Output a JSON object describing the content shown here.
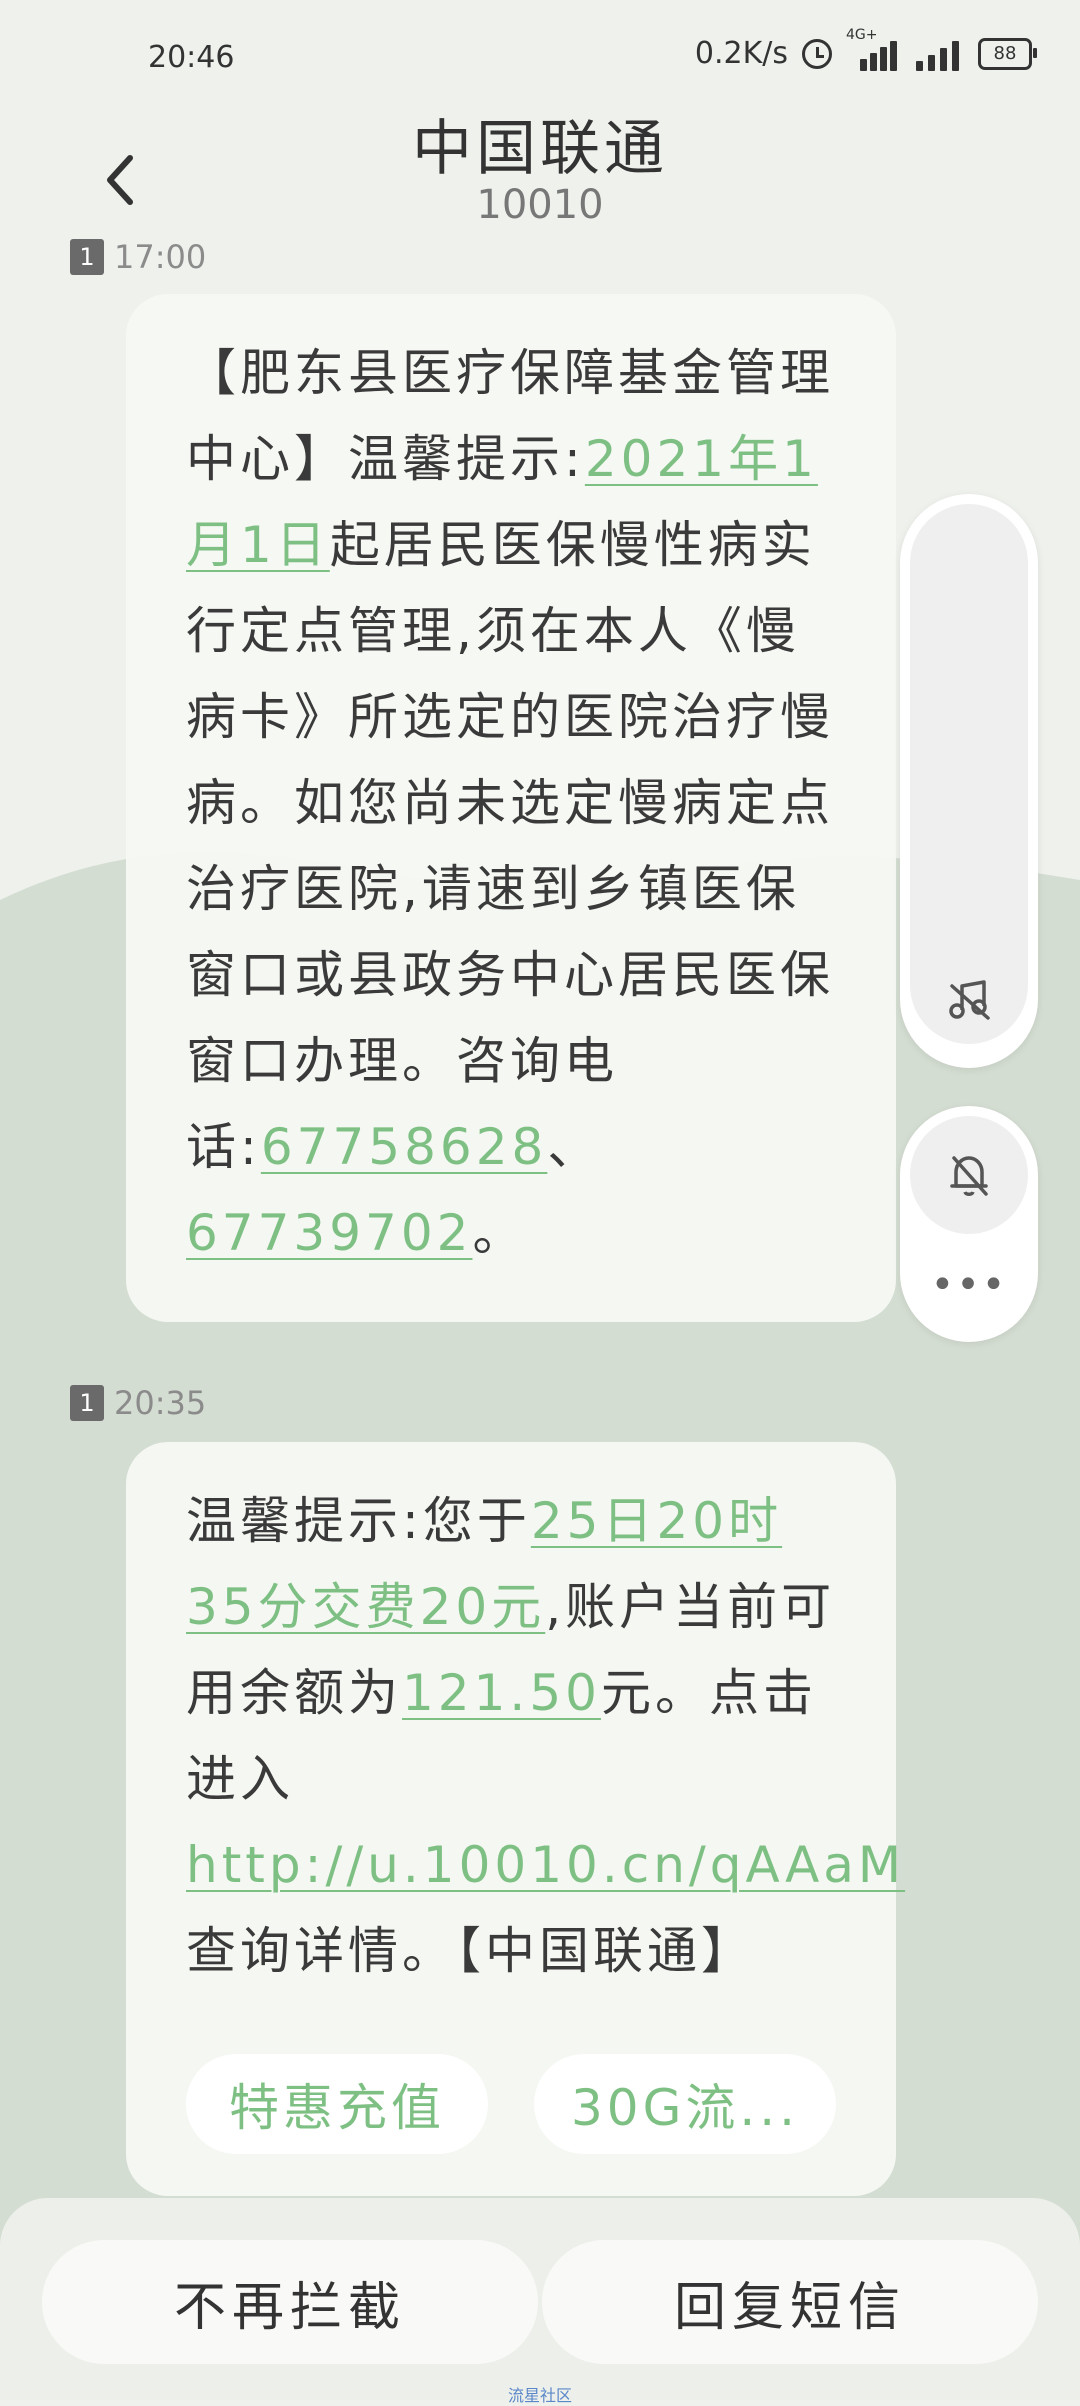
{
  "status_bar": {
    "time": "20:46",
    "speed": "0.2K/s",
    "network_tag": "4G+",
    "battery": "88"
  },
  "header": {
    "title": "中国联通",
    "number": "10010"
  },
  "messages": [
    {
      "sim": "1",
      "time": "17:00",
      "parts": [
        {
          "t": "【肥东县医疗保障基金管理中心】温馨提示:"
        },
        {
          "t": "2021年1月1日",
          "link": true
        },
        {
          "t": "起居民医保慢性病实行定点管理,须在本人《慢病卡》所选定的医院治疗慢病。如您尚未选定慢病定点治疗医院,请速到乡镇医保窗口或县政务中心居民医保窗口办理。咨询电话:"
        },
        {
          "t": "67758628",
          "link": true
        },
        {
          "t": "、"
        },
        {
          "t": "67739702",
          "link": true
        },
        {
          "t": "。"
        }
      ]
    },
    {
      "sim": "1",
      "time": "20:35",
      "parts": [
        {
          "t": "温馨提示:您于"
        },
        {
          "t": "25日20时35分交费20元",
          "link": true
        },
        {
          "t": ",账户当前可用余额为"
        },
        {
          "t": "121.50",
          "link": true
        },
        {
          "t": "元。点击进入 "
        },
        {
          "t": "http://u.10010.cn/qAAaM",
          "link": true
        },
        {
          "t": " 查询详情。【中国联通】"
        }
      ],
      "quick_replies": [
        "特惠充值",
        "30G流..."
      ]
    }
  ],
  "actions": {
    "unblock": "不再拦截",
    "reply": "回复短信"
  },
  "watermark": "流星社区",
  "colors": {
    "link": "#7ec083",
    "background": "#eef1ec",
    "wave": "#d4ddd2"
  }
}
